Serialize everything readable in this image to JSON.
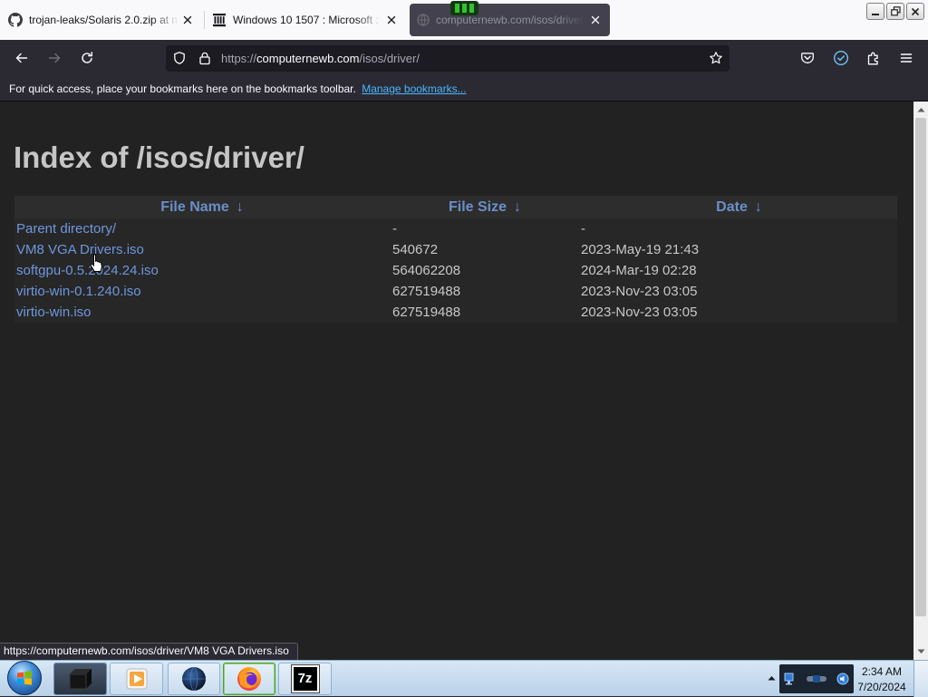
{
  "browser": {
    "tabs": [
      {
        "title": "trojan-leaks/Solaris 2.0.zip at m",
        "icon": "github-icon",
        "active": false
      },
      {
        "title": "Windows 10 1507 : Microsoft : I",
        "icon": "archive-icon",
        "active": false
      },
      {
        "title": "computernewb.com/isos/driver/",
        "icon": "globe-icon",
        "active": true
      }
    ],
    "window_controls": [
      "minimize-icon",
      "restore-icon",
      "close-icon"
    ],
    "toolbar_icons": [
      "back-arrow-icon",
      "forward-arrow-icon",
      "reload-icon",
      "shield-icon",
      "lock-icon",
      "star-icon",
      "pocket-icon",
      "account-icon",
      "extensions-icon",
      "menu-icon"
    ],
    "address": {
      "scheme": "https://",
      "host": "computernewb.com",
      "path": "/isos/driver/"
    },
    "bookmarks_bar": {
      "message": "For quick access, place your bookmarks here on the bookmarks toolbar.",
      "manage_link": "Manage bookmarks..."
    },
    "status_url": "https://computernewb.com/isos/driver/VM8 VGA Drivers.iso"
  },
  "page": {
    "heading": "Index of /isos/driver/",
    "columns": [
      {
        "label": "File Name",
        "sort": "↓"
      },
      {
        "label": "File Size",
        "sort": "↓"
      },
      {
        "label": "Date",
        "sort": "↓"
      }
    ],
    "rows": [
      {
        "name": "Parent directory/",
        "size": "-",
        "date": "-"
      },
      {
        "name": "VM8 VGA Drivers.iso",
        "size": "540672",
        "date": "2023-May-19 21:43"
      },
      {
        "name": "softgpu-0.5.2024.24.iso",
        "size": "564062208",
        "date": "2024-Mar-19 02:28"
      },
      {
        "name": "virtio-win-0.1.240.iso",
        "size": "627519488",
        "date": "2023-Nov-23 03:05"
      },
      {
        "name": "virtio-win.iso",
        "size": "627519488",
        "date": "2023-Nov-23 03:05"
      }
    ]
  },
  "taskbar": {
    "start_icon": "windows-start-orb-icon",
    "apps": [
      {
        "icon": "black-box-icon"
      },
      {
        "icon": "media-player-icon"
      },
      {
        "icon": "globe-icon"
      },
      {
        "icon": "firefox-icon",
        "active": true
      },
      {
        "icon": "7zip-icon",
        "label": "7z"
      }
    ],
    "tray_icons": [
      "show-hidden-icons-icon",
      "network-icon",
      "device-icon",
      "volume-icon"
    ],
    "clock": {
      "time": "2:34 AM",
      "date": "7/20/2024"
    }
  },
  "colors": {
    "tabstrip": "#f9f9fb",
    "active_tab": "#42414d",
    "toolbar": "#2b2a33",
    "urlbar": "#1c1b22",
    "bookmark_link": "#49b8ff",
    "page_bg": "#222222",
    "heading_text": "#c6c6c6",
    "header_text": "#6a8fc8",
    "table_header_bg": "#2d2d2d",
    "table_body_bg": "#272727",
    "link": "#6d97dc",
    "cell_text": "#c8c8c8",
    "taskbar": "#b9d1e8"
  }
}
